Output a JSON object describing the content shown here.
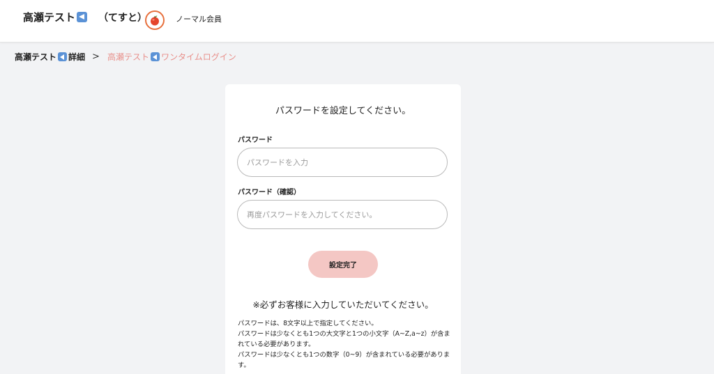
{
  "header": {
    "user_name": "高瀬テスト",
    "user_kana": "（てすと）",
    "membership": "ノーマル会員",
    "avatar_icon": "apple-icon"
  },
  "breadcrumb": {
    "parent_prefix": "高瀬テスト",
    "parent_suffix": "詳細",
    "separator": ">",
    "current_prefix": "高瀬テスト",
    "current_suffix": "ワンタイムログイン"
  },
  "form": {
    "title": "パスワードを設定してください。",
    "password_label": "パスワード",
    "password_placeholder": "パスワードを入力",
    "confirm_label": "パスワード（確認）",
    "confirm_placeholder": "再度パスワードを入力してください。",
    "submit_label": "設定完了",
    "notice": "※必ずお客様に入力していただいてください。",
    "rules": [
      "パスワードは、8文字以上で指定してください。",
      "パスワードは少なくとも1つの大文字と1つの小文字（A~Z,a~z）が含まれている必要があります。",
      "パスワードは少なくとも1つの数字（0~9）が含まれている必要があります。"
    ]
  },
  "colors": {
    "accent": "#e88f8a",
    "button": "#f4c7c4",
    "emoji_icon": "#5b92d6",
    "avatar_ring": "#e7703d"
  }
}
